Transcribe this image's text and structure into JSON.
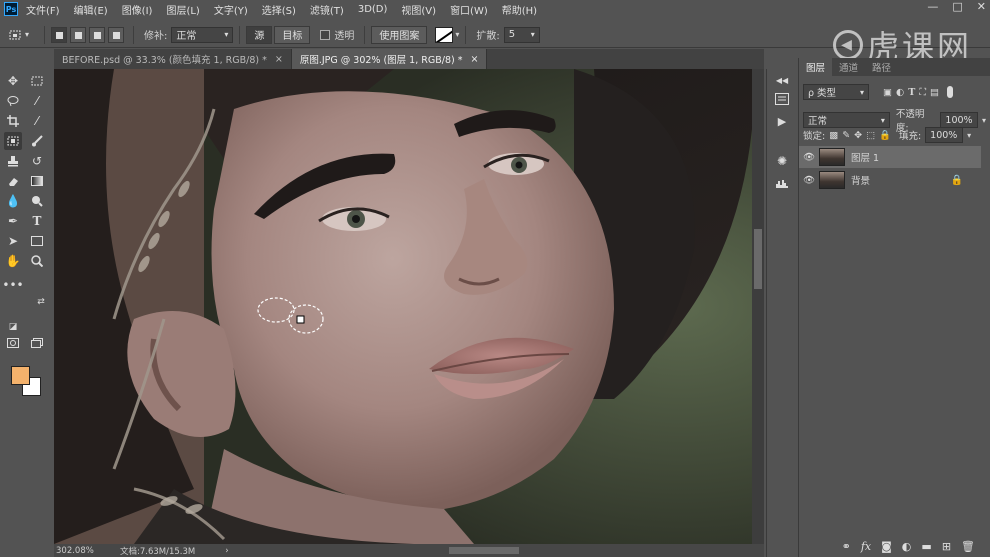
{
  "app": {
    "logo": "Ps"
  },
  "menu": [
    "文件(F)",
    "编辑(E)",
    "图像(I)",
    "图层(L)",
    "文字(Y)",
    "选择(S)",
    "滤镜(T)",
    "3D(D)",
    "视图(V)",
    "窗口(W)",
    "帮助(H)"
  ],
  "window_controls": [
    "—",
    "□",
    "✕"
  ],
  "options": {
    "repair_label": "修补:",
    "repair_mode": "正常",
    "source_label": "源",
    "dest_label": "目标",
    "transparent_label": "透明",
    "use_pattern_label": "使用图案",
    "diffusion_label": "扩散:",
    "diffusion_value": "5"
  },
  "watermark": {
    "text": "虎课网",
    "circle": "◀"
  },
  "tabs": [
    {
      "label": "BEFORE.psd @ 33.3% (颜色填充 1, RGB/8) *",
      "close": "×"
    },
    {
      "label": "原图.JPG @ 302% (图层 1, RGB/8) *",
      "close": "×"
    }
  ],
  "status": {
    "zoom": "302.08%",
    "doc": "文档:7.63M/15.3M",
    "arrow": "›"
  },
  "colors": {
    "foreground": "#f4b26c",
    "background": "#ffffff"
  },
  "layers_panel": {
    "tabs": [
      "图层",
      "通道",
      "路径"
    ],
    "filter_label": "ρ 类型",
    "blend_mode": "正常",
    "opacity_label": "不透明度:",
    "opacity_value": "100%",
    "lock_label": "锁定:",
    "fill_label": "填充:",
    "fill_value": "100%",
    "layers": [
      {
        "name": "图层 1",
        "selected": true,
        "locked": false
      },
      {
        "name": "背景",
        "selected": false,
        "locked": true
      }
    ]
  }
}
